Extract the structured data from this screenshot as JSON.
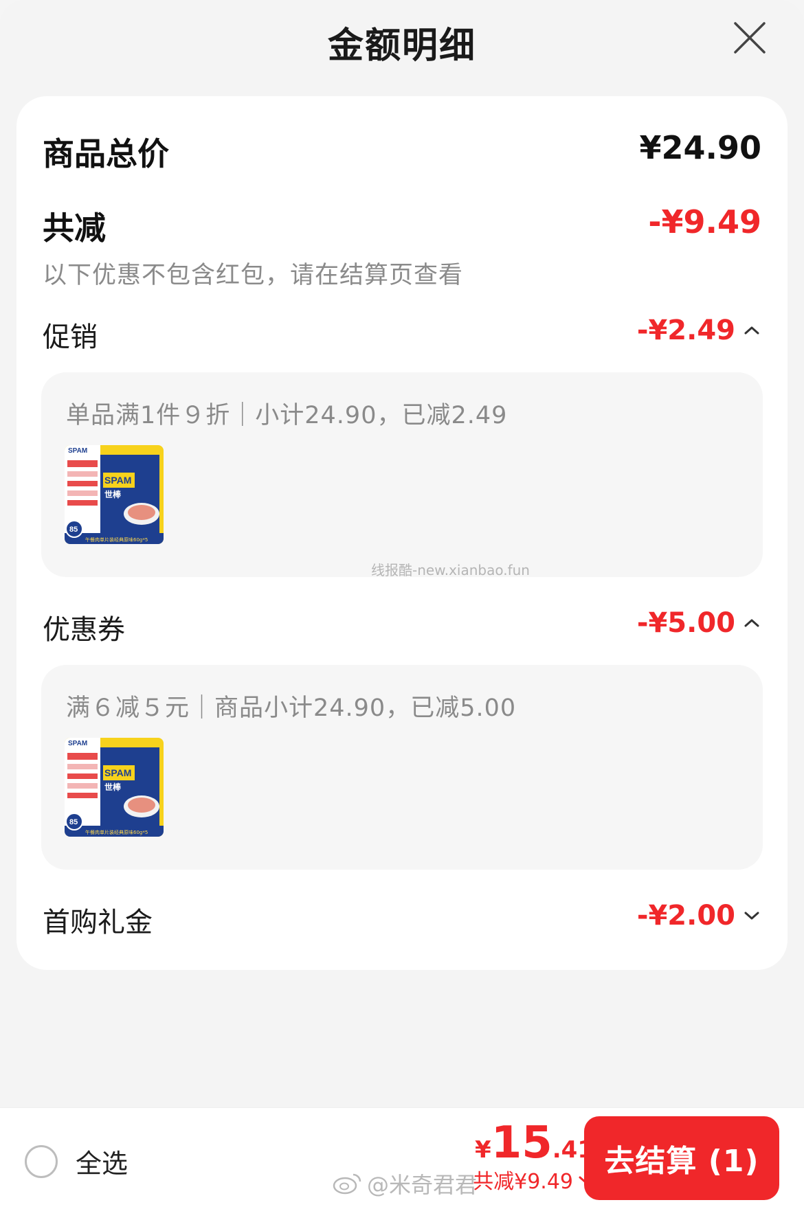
{
  "header": {
    "title": "金额明细"
  },
  "summary": {
    "total_label": "商品总价",
    "total_value": "¥24.90",
    "saved_label": "共减",
    "saved_value": "-¥9.49",
    "note": "以下优惠不包含红包，请在结算页查看"
  },
  "sections": {
    "promo": {
      "label": "促销",
      "value": "-¥2.49",
      "expanded": true,
      "detail": "单品满1件９折｜小计24.90，已减2.49",
      "watermark": "线报酷-new.xianbao.fun"
    },
    "coupon": {
      "label": "优惠券",
      "value": "-¥5.00",
      "expanded": true,
      "detail": "满６减５元｜商品小计24.90，已减5.00"
    },
    "gift": {
      "label": "首购礼金",
      "value": "-¥2.00",
      "expanded": false
    }
  },
  "product_thumb": {
    "brand": "SPAM",
    "brand_cn": "世棒",
    "caption": "午餐肉单片装经典原味60g*5",
    "badge": "85"
  },
  "bottom_bar": {
    "select_all_label": "全选",
    "price_currency": "¥",
    "price_integer": "15",
    "price_decimal": ".41",
    "saved_text": "共减¥9.49",
    "checkout_label": "去结算 (1)"
  },
  "watermark_weibo": "@米奇君君",
  "colors": {
    "accent_red": "#f0272a",
    "text_dark": "#1a1a1a",
    "text_muted": "#8a8a8a",
    "background": "#f4f4f4",
    "card": "#ffffff"
  },
  "icons": {
    "close": "close-icon",
    "chevron_up": "chevron-up-icon",
    "chevron_down": "chevron-down-icon",
    "weibo": "weibo-icon"
  }
}
